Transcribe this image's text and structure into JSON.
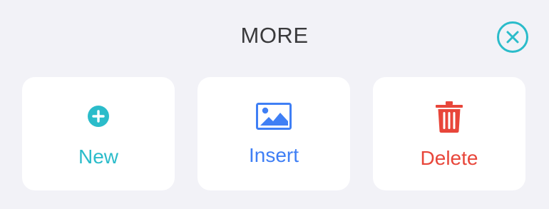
{
  "sheet": {
    "title": "MORE",
    "close_icon": "close-circle-icon"
  },
  "actions": [
    {
      "label": "New",
      "icon": "plus-circle-icon",
      "color": "#2bbcca"
    },
    {
      "label": "Insert",
      "icon": "image-icon",
      "color": "#3f7ff5"
    },
    {
      "label": "Delete",
      "icon": "trash-icon",
      "color": "#e8463a"
    }
  ],
  "colors": {
    "background": "#f2f2f7",
    "tile": "#ffffff",
    "title": "#3a3a3c",
    "accent": "#2bbcca"
  }
}
